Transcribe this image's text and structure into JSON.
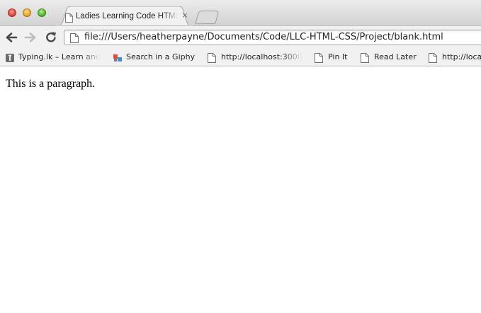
{
  "browser": {
    "tab": {
      "title": "Ladies Learning Code HTML & CSS",
      "close_glyph": "×",
      "icon": "document-icon"
    },
    "address_bar": {
      "url": "file:///Users/heatherpayne/Documents/Code/LLC-HTML-CSS/Project/blank.html",
      "icon": "document-icon"
    },
    "nav": {
      "back_icon": "back-arrow-icon",
      "forward_icon": "forward-arrow-icon",
      "reload_icon": "reload-icon"
    },
    "bookmarks": [
      {
        "label": "Typing.lk – Learn and",
        "icon": "typing-favicon"
      },
      {
        "label": "Search in a Giphy",
        "icon": "giphy-favicon"
      },
      {
        "label": "http://localhost:3000",
        "icon": "document-icon"
      },
      {
        "label": "Pin It",
        "icon": "document-icon"
      },
      {
        "label": "Read Later",
        "icon": "document-icon"
      },
      {
        "label": "http://localhost",
        "icon": "document-icon"
      }
    ]
  },
  "page": {
    "paragraph": "This is a paragraph."
  }
}
